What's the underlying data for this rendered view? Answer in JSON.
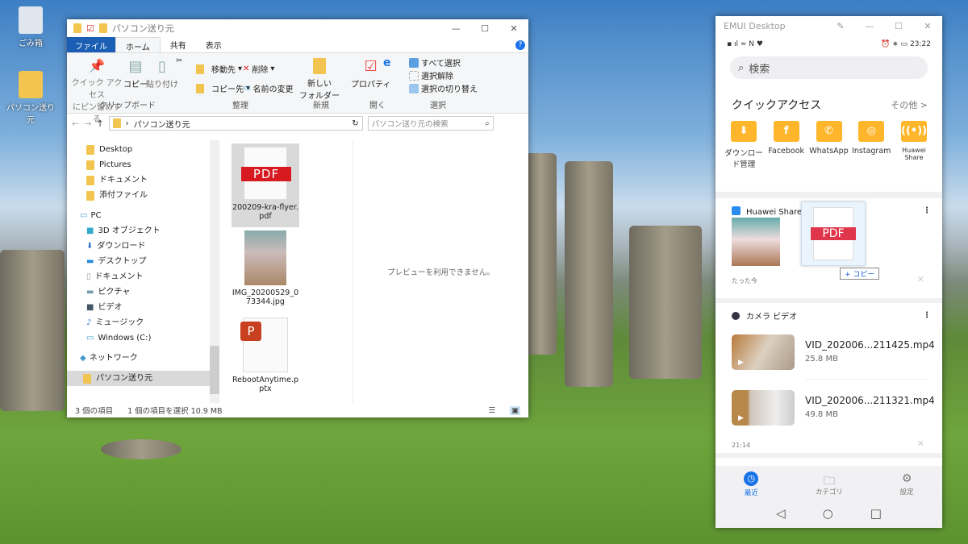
{
  "desktop": {
    "icons": [
      {
        "label": "ごみ箱"
      },
      {
        "label": "パソコン送り元"
      }
    ]
  },
  "explorer": {
    "title": "パソコン送り元",
    "tabs": [
      "ファイル",
      "ホーム",
      "共有",
      "表示"
    ],
    "ribbon": {
      "clipboard": {
        "pin": "クイック アクセス\nにピン留めする",
        "copy": "コピー",
        "paste": "貼り付け",
        "group": "クリップボード"
      },
      "organize": {
        "move": "移動先",
        "delete": "削除",
        "copy_to": "コピー先",
        "rename": "名前の変更",
        "group": "整理"
      },
      "new": {
        "new_folder": "新しい\nフォルダー",
        "group": "新規"
      },
      "open": {
        "properties": "プロパティ",
        "group": "開く"
      },
      "select": {
        "select_all": "すべて選択",
        "select_none": "選択解除",
        "invert": "選択の切り替え",
        "group": "選択"
      }
    },
    "address": {
      "path": "パソコン送り元",
      "search_placeholder": "パソコン送り元の検索"
    },
    "nav": {
      "quick": [
        "Desktop",
        "Pictures",
        "ドキュメント",
        "添付ファイル"
      ],
      "pc": "PC",
      "pc_items": [
        "3D オブジェクト",
        "ダウンロード",
        "デスクトップ",
        "ドキュメント",
        "ピクチャ",
        "ビデオ",
        "ミュージック",
        "Windows (C:)"
      ],
      "network": "ネットワーク",
      "selected": "パソコン送り元"
    },
    "files": [
      {
        "name": "200209-kra-flyer.pdf",
        "badge": "PDF"
      },
      {
        "name": "IMG_20200529_073344.jpg"
      },
      {
        "name": "RebootAnytime.pptx",
        "badge": "P"
      }
    ],
    "preview": "プレビューを利用できません。",
    "status": {
      "count": "3 個の項目",
      "selected": "1 個の項目を選択  10.9 MB"
    }
  },
  "phone": {
    "title": "EMUI Desktop",
    "time": "23:22",
    "search_placeholder": "検索",
    "quick_access": {
      "title": "クイックアクセス",
      "more": "その他 >",
      "items": [
        "ダウンロード管理",
        "Facebook",
        "WhatsApp",
        "Instagram",
        "Huawei Share"
      ]
    },
    "share_card": {
      "title": "Huawei Share 画像",
      "time": "たった今",
      "drag_badge": "PDF",
      "copy_label": "+ コピー"
    },
    "video_card": {
      "title": "カメラ ビデオ",
      "time": "21:14",
      "videos": [
        {
          "name": "VID_202006...211425.mp4",
          "size": "25.8 MB"
        },
        {
          "name": "VID_202006...211321.mp4",
          "size": "49.8 MB"
        }
      ]
    },
    "bottom_nav": [
      {
        "label": "最近"
      },
      {
        "label": "カテゴリ"
      },
      {
        "label": "設定"
      }
    ],
    "accent": "#1a73e8"
  }
}
